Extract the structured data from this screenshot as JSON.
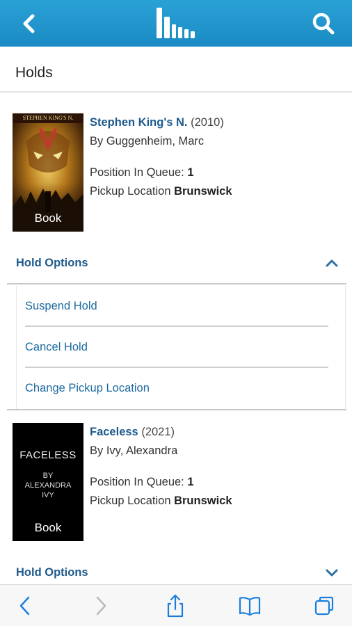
{
  "header": {
    "back_icon": "chevron-left-icon",
    "logo_icon": "library-bars-logo",
    "search_icon": "search-icon",
    "background": "#1e95cd"
  },
  "page": {
    "title": "Holds"
  },
  "holds": [
    {
      "cover_label": "Book",
      "cover_art_text": "STEPHEN KING'S N.",
      "title": "Stephen King's N.",
      "year": "(2010)",
      "author": "By Guggenheim, Marc",
      "queue_label": "Position In Queue:",
      "queue_value": "1",
      "pickup_label": "Pickup Location",
      "pickup_value": "Brunswick",
      "options_label": "Hold Options",
      "options_expanded": true,
      "options": [
        "Suspend Hold",
        "Cancel Hold",
        "Change Pickup Location"
      ]
    },
    {
      "cover_label": "Book",
      "cover_title": "FACELESS",
      "cover_by": "BY",
      "cover_author_1": "ALEXANDRA",
      "cover_author_2": "IVY",
      "title": "Faceless",
      "year": "(2021)",
      "author": "By Ivy, Alexandra",
      "queue_label": "Position In Queue:",
      "queue_value": "1",
      "pickup_label": "Pickup Location",
      "pickup_value": "Brunswick",
      "options_label": "Hold Options",
      "options_expanded": false
    }
  ],
  "browser_toolbar": {
    "items": [
      "back-icon",
      "forward-icon",
      "share-icon",
      "bookmarks-icon",
      "tabs-icon"
    ]
  }
}
